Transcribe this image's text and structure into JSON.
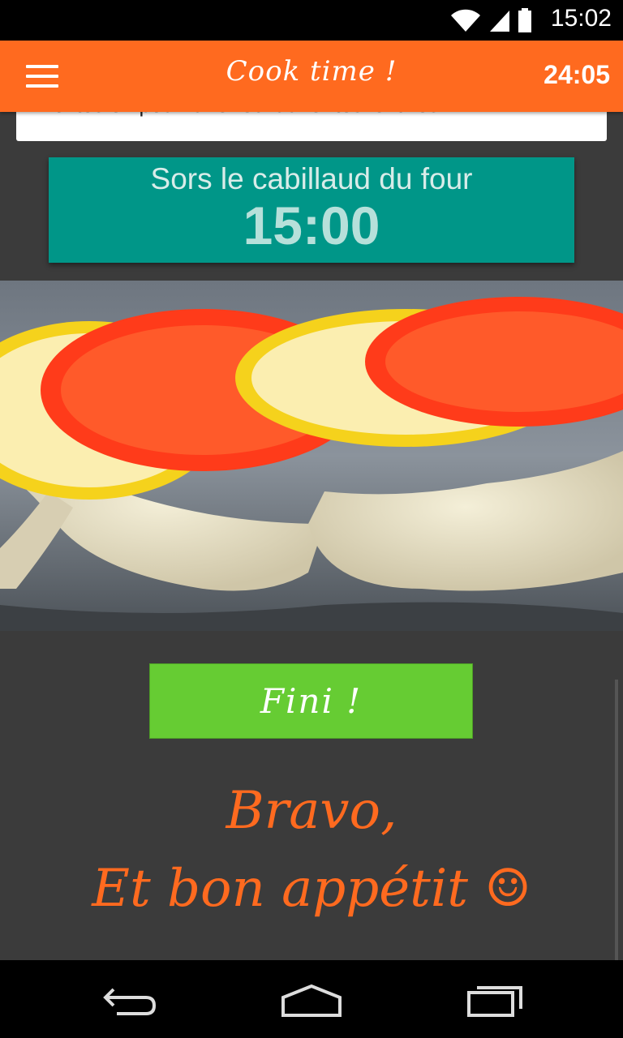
{
  "status_bar": {
    "time": "15:02"
  },
  "app_bar": {
    "title": "Cook time !",
    "timer": "24:05"
  },
  "previous_step": {
    "text": "Profites en pour faire réchauffer tes lentilles !"
  },
  "current_step": {
    "label": "Sors le cabillaud du four",
    "time": "15:00"
  },
  "photo": {
    "description_icon": "dish-photo"
  },
  "done_button": {
    "label": "Fini !"
  },
  "message": {
    "line1": "Bravo,",
    "line2": "Et bon appétit ☺"
  },
  "colors": {
    "accent": "#ff6a1f",
    "teal": "#009688",
    "green": "#66cc33",
    "background": "#3b3b3b"
  }
}
